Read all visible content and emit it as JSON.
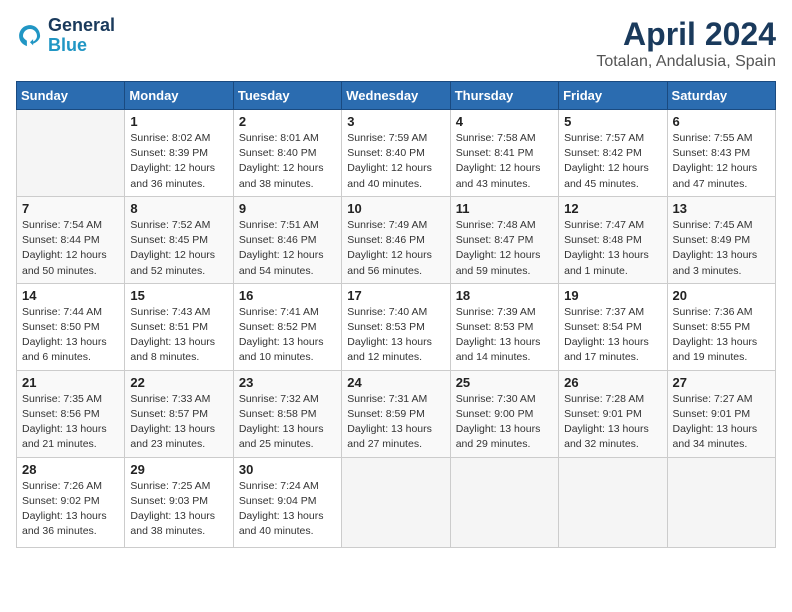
{
  "header": {
    "logo_line1": "General",
    "logo_line2": "Blue",
    "month": "April 2024",
    "location": "Totalan, Andalusia, Spain"
  },
  "columns": [
    "Sunday",
    "Monday",
    "Tuesday",
    "Wednesday",
    "Thursday",
    "Friday",
    "Saturday"
  ],
  "weeks": [
    [
      {
        "day": "",
        "info": ""
      },
      {
        "day": "1",
        "info": "Sunrise: 8:02 AM\nSunset: 8:39 PM\nDaylight: 12 hours\nand 36 minutes."
      },
      {
        "day": "2",
        "info": "Sunrise: 8:01 AM\nSunset: 8:40 PM\nDaylight: 12 hours\nand 38 minutes."
      },
      {
        "day": "3",
        "info": "Sunrise: 7:59 AM\nSunset: 8:40 PM\nDaylight: 12 hours\nand 40 minutes."
      },
      {
        "day": "4",
        "info": "Sunrise: 7:58 AM\nSunset: 8:41 PM\nDaylight: 12 hours\nand 43 minutes."
      },
      {
        "day": "5",
        "info": "Sunrise: 7:57 AM\nSunset: 8:42 PM\nDaylight: 12 hours\nand 45 minutes."
      },
      {
        "day": "6",
        "info": "Sunrise: 7:55 AM\nSunset: 8:43 PM\nDaylight: 12 hours\nand 47 minutes."
      }
    ],
    [
      {
        "day": "7",
        "info": "Sunrise: 7:54 AM\nSunset: 8:44 PM\nDaylight: 12 hours\nand 50 minutes."
      },
      {
        "day": "8",
        "info": "Sunrise: 7:52 AM\nSunset: 8:45 PM\nDaylight: 12 hours\nand 52 minutes."
      },
      {
        "day": "9",
        "info": "Sunrise: 7:51 AM\nSunset: 8:46 PM\nDaylight: 12 hours\nand 54 minutes."
      },
      {
        "day": "10",
        "info": "Sunrise: 7:49 AM\nSunset: 8:46 PM\nDaylight: 12 hours\nand 56 minutes."
      },
      {
        "day": "11",
        "info": "Sunrise: 7:48 AM\nSunset: 8:47 PM\nDaylight: 12 hours\nand 59 minutes."
      },
      {
        "day": "12",
        "info": "Sunrise: 7:47 AM\nSunset: 8:48 PM\nDaylight: 13 hours\nand 1 minute."
      },
      {
        "day": "13",
        "info": "Sunrise: 7:45 AM\nSunset: 8:49 PM\nDaylight: 13 hours\nand 3 minutes."
      }
    ],
    [
      {
        "day": "14",
        "info": "Sunrise: 7:44 AM\nSunset: 8:50 PM\nDaylight: 13 hours\nand 6 minutes."
      },
      {
        "day": "15",
        "info": "Sunrise: 7:43 AM\nSunset: 8:51 PM\nDaylight: 13 hours\nand 8 minutes."
      },
      {
        "day": "16",
        "info": "Sunrise: 7:41 AM\nSunset: 8:52 PM\nDaylight: 13 hours\nand 10 minutes."
      },
      {
        "day": "17",
        "info": "Sunrise: 7:40 AM\nSunset: 8:53 PM\nDaylight: 13 hours\nand 12 minutes."
      },
      {
        "day": "18",
        "info": "Sunrise: 7:39 AM\nSunset: 8:53 PM\nDaylight: 13 hours\nand 14 minutes."
      },
      {
        "day": "19",
        "info": "Sunrise: 7:37 AM\nSunset: 8:54 PM\nDaylight: 13 hours\nand 17 minutes."
      },
      {
        "day": "20",
        "info": "Sunrise: 7:36 AM\nSunset: 8:55 PM\nDaylight: 13 hours\nand 19 minutes."
      }
    ],
    [
      {
        "day": "21",
        "info": "Sunrise: 7:35 AM\nSunset: 8:56 PM\nDaylight: 13 hours\nand 21 minutes."
      },
      {
        "day": "22",
        "info": "Sunrise: 7:33 AM\nSunset: 8:57 PM\nDaylight: 13 hours\nand 23 minutes."
      },
      {
        "day": "23",
        "info": "Sunrise: 7:32 AM\nSunset: 8:58 PM\nDaylight: 13 hours\nand 25 minutes."
      },
      {
        "day": "24",
        "info": "Sunrise: 7:31 AM\nSunset: 8:59 PM\nDaylight: 13 hours\nand 27 minutes."
      },
      {
        "day": "25",
        "info": "Sunrise: 7:30 AM\nSunset: 9:00 PM\nDaylight: 13 hours\nand 29 minutes."
      },
      {
        "day": "26",
        "info": "Sunrise: 7:28 AM\nSunset: 9:01 PM\nDaylight: 13 hours\nand 32 minutes."
      },
      {
        "day": "27",
        "info": "Sunrise: 7:27 AM\nSunset: 9:01 PM\nDaylight: 13 hours\nand 34 minutes."
      }
    ],
    [
      {
        "day": "28",
        "info": "Sunrise: 7:26 AM\nSunset: 9:02 PM\nDaylight: 13 hours\nand 36 minutes."
      },
      {
        "day": "29",
        "info": "Sunrise: 7:25 AM\nSunset: 9:03 PM\nDaylight: 13 hours\nand 38 minutes."
      },
      {
        "day": "30",
        "info": "Sunrise: 7:24 AM\nSunset: 9:04 PM\nDaylight: 13 hours\nand 40 minutes."
      },
      {
        "day": "",
        "info": ""
      },
      {
        "day": "",
        "info": ""
      },
      {
        "day": "",
        "info": ""
      },
      {
        "day": "",
        "info": ""
      }
    ]
  ]
}
